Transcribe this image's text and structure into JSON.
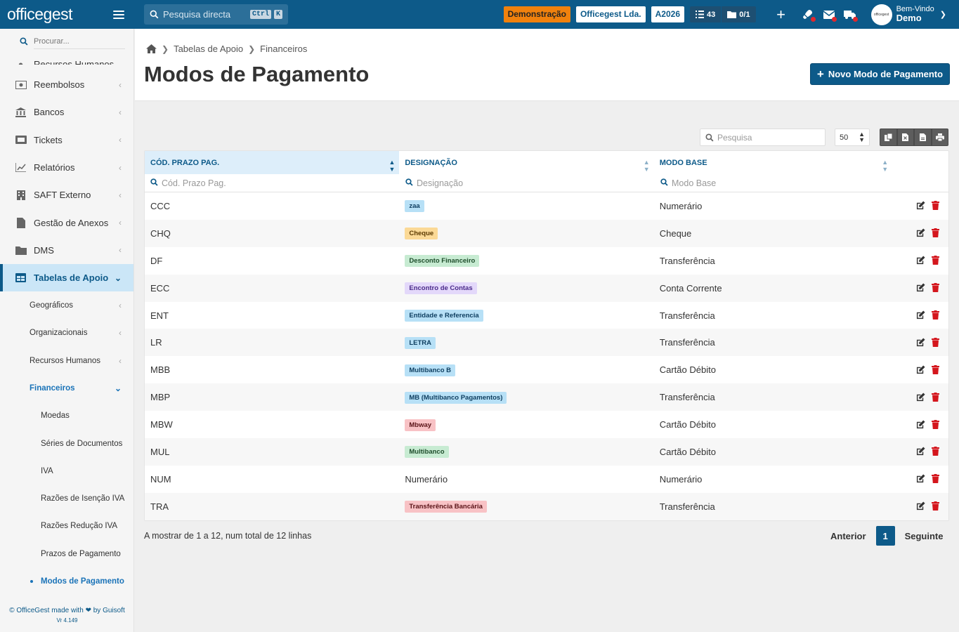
{
  "app": {
    "logo": "officegest"
  },
  "topbar": {
    "search_placeholder": "Pesquisa directa",
    "kbd1": "Ctrl",
    "kbd2": "K",
    "demo_badge": "Demonstração",
    "company_badge": "Officegest Lda.",
    "year_badge": "A2026",
    "tasks_count": "43",
    "folders_count": "0/1",
    "user_greeting": "Bem-Vindo",
    "user_name": "Demo",
    "avatar_text": "officegest"
  },
  "sidebar": {
    "search_placeholder": "Procurar...",
    "cut_item": "Recursos Humanos",
    "items": [
      {
        "label": "Reembolsos",
        "icon": "receipt-icon"
      },
      {
        "label": "Bancos",
        "icon": "bank-icon"
      },
      {
        "label": "Tickets",
        "icon": "ticket-icon"
      },
      {
        "label": "Relatórios",
        "icon": "chart-icon"
      },
      {
        "label": "SAFT Externo",
        "icon": "building-icon"
      },
      {
        "label": "Gestão de Anexos",
        "icon": "file-icon"
      },
      {
        "label": "DMS",
        "icon": "folder-icon"
      }
    ],
    "active_item": "Tabelas de Apoio",
    "sub_items": [
      "Geográficos",
      "Organizacionais",
      "Recursos Humanos"
    ],
    "open_sub": "Financeiros",
    "sub2_items": [
      "Moedas",
      "Séries de Documentos",
      "IVA",
      "Razões de Isenção IVA",
      "Razões Redução IVA",
      "Prazos de Pagamento"
    ],
    "current_sub2": "Modos de Pagamento",
    "footer_left": "© OfficeGest made with",
    "footer_right": "by Guisoft",
    "version": "Vr 4.149"
  },
  "page": {
    "breadcrumb": [
      "Tabelas de Apoio",
      "Financeiros"
    ],
    "title": "Modos de Pagamento",
    "new_button": "Novo Modo de Pagamento"
  },
  "toolbar": {
    "search_placeholder": "Pesquisa",
    "page_size": "50"
  },
  "table": {
    "columns": [
      "CÓD. PRAZO PAG.",
      "DESIGNAÇÃO",
      "MODO BASE"
    ],
    "filters": [
      "Cód. Prazo Pag.",
      "Designação",
      "Modo Base"
    ],
    "rows": [
      {
        "code": "CCC",
        "name": "zaa",
        "badge": "blue",
        "base": "Numerário"
      },
      {
        "code": "CHQ",
        "name": "Cheque",
        "badge": "yellow",
        "base": "Cheque"
      },
      {
        "code": "DF",
        "name": "Desconto Financeiro",
        "badge": "green",
        "base": "Transferência"
      },
      {
        "code": "ECC",
        "name": "Encontro de Contas",
        "badge": "purple",
        "base": "Conta Corrente"
      },
      {
        "code": "ENT",
        "name": "Entidade e Referencia",
        "badge": "blue",
        "base": "Transferência"
      },
      {
        "code": "LR",
        "name": "LETRA",
        "badge": "blue",
        "base": "Transferência"
      },
      {
        "code": "MBB",
        "name": "Multibanco B",
        "badge": "blue",
        "base": "Cartão Débito"
      },
      {
        "code": "MBP",
        "name": "MB (Multibanco Pagamentos)",
        "badge": "blue",
        "base": "Transferência"
      },
      {
        "code": "MBW",
        "name": "Mbway",
        "badge": "red",
        "base": "Cartão Débito"
      },
      {
        "code": "MUL",
        "name": "Multibanco",
        "badge": "green",
        "base": "Cartão Débito"
      },
      {
        "code": "NUM",
        "name": "Numerário",
        "badge": "",
        "base": "Numerário"
      },
      {
        "code": "TRA",
        "name": "Transferência Bancária",
        "badge": "red",
        "base": "Transferência"
      }
    ]
  },
  "footer": {
    "info": "A mostrar de 1 a 12, num total de 12 linhas",
    "prev": "Anterior",
    "page": "1",
    "next": "Seguinte"
  },
  "colors": {
    "brand": "#0d5a89",
    "accent_orange": "#f0810d",
    "delete_red": "#d4161d"
  }
}
